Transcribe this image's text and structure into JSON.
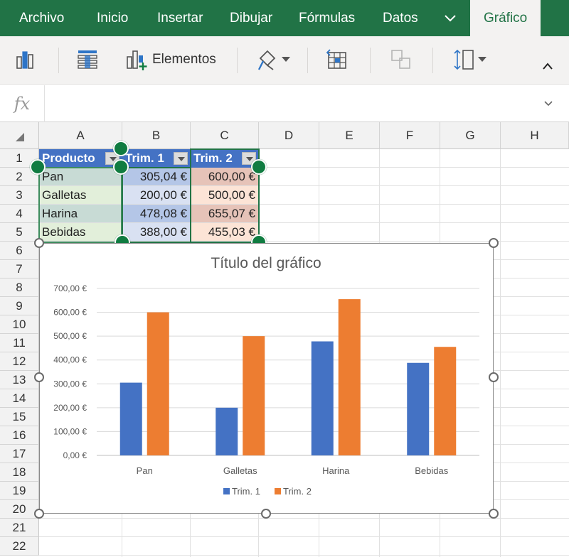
{
  "menu": {
    "items": [
      "Archivo",
      "Inicio",
      "Insertar",
      "Dibujar",
      "Fórmulas",
      "Datos"
    ],
    "active": "Gráfico"
  },
  "ribbon": {
    "elements_label": "Elementos"
  },
  "formula_bar": {
    "fx_label": "fx",
    "value": ""
  },
  "sheet": {
    "columns": [
      "A",
      "B",
      "C",
      "D",
      "E",
      "F",
      "G",
      "H"
    ],
    "rows": [
      "1",
      "2",
      "3",
      "4",
      "5",
      "6",
      "7",
      "8",
      "9",
      "10",
      "11",
      "12",
      "13",
      "14",
      "15",
      "16",
      "17",
      "18",
      "19",
      "20",
      "21",
      "22"
    ],
    "table": {
      "headers": [
        "Producto",
        "Trim. 1",
        "Trim. 2"
      ],
      "rows": [
        [
          "Pan",
          "305,04 €",
          "600,00 €"
        ],
        [
          "Galletas",
          "200,00 €",
          "500,00 €"
        ],
        [
          "Harina",
          "478,08 €",
          "655,07 €"
        ],
        [
          "Bebidas",
          "388,00 €",
          "455,03 €"
        ]
      ]
    },
    "colors": {
      "col_a_header": "#4472c4",
      "col_b_header": "#4472c4",
      "col_c_header": "#4472c4",
      "col_a_band_even": "#c8dbd5",
      "col_a_band_odd": "#e2efda",
      "col_b_band_even": "#b4c6e7",
      "col_b_band_odd": "#d9e1f2",
      "col_c_band_even": "#e6c3b8",
      "col_c_band_odd": "#fce4d6",
      "selection": "#217346"
    }
  },
  "chart_data": {
    "type": "bar",
    "title": "Título del gráfico",
    "categories": [
      "Pan",
      "Galletas",
      "Harina",
      "Bebidas"
    ],
    "series": [
      {
        "name": "Trim. 1",
        "values": [
          305.04,
          200.0,
          478.08,
          388.0
        ],
        "color": "#4472c4"
      },
      {
        "name": "Trim. 2",
        "values": [
          600.0,
          500.0,
          655.07,
          455.03
        ],
        "color": "#ed7d31"
      }
    ],
    "y_ticks": [
      "0,00 €",
      "100,00 €",
      "200,00 €",
      "300,00 €",
      "400,00 €",
      "500,00 €",
      "600,00 €",
      "700,00 €"
    ],
    "ylim": [
      0,
      700
    ],
    "gridlines": true,
    "legend_position": "bottom"
  }
}
